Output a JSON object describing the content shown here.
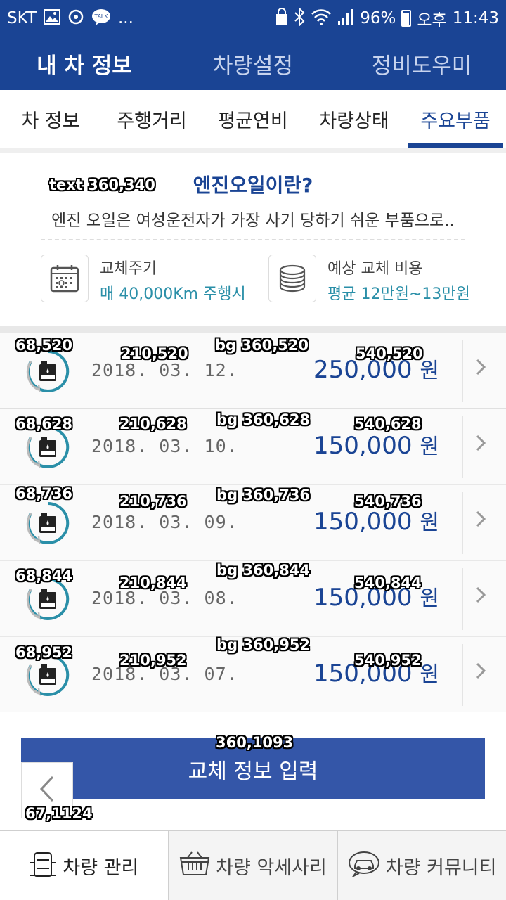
{
  "status_bar": {
    "carrier": "SKT",
    "talk_label": "TALK",
    "more": "...",
    "battery": "96%",
    "ampm": "오후",
    "time": "11:43"
  },
  "top_nav": {
    "items": [
      "내 차 정보",
      "차량설정",
      "정비도우미"
    ],
    "active": "내 차 정보"
  },
  "sub_tabs": {
    "items": [
      "차 정보",
      "주행거리",
      "평균연비",
      "차량상태",
      "주요부품"
    ],
    "active": "주요부품"
  },
  "info": {
    "title": "엔진오일이란?",
    "description": "엔진 오일은 여성운전자가 가장 사기 당하기 쉬운 부품으로..",
    "cycle_label": "교체주기",
    "cycle_value": "매 40,000Km 주행시",
    "cost_label": "예상 교체 비용",
    "cost_value": "평균 12만원~13만원",
    "calendar_icon": "calendar-icon",
    "coins_icon": "coins-icon"
  },
  "history": [
    {
      "date": "2018. 03. 12.",
      "amount": "250,000",
      "unit": "원"
    },
    {
      "date": "2018. 03. 10.",
      "amount": "150,000",
      "unit": "원"
    },
    {
      "date": "2018. 03. 09.",
      "amount": "150,000",
      "unit": "원"
    },
    {
      "date": "2018. 03. 08.",
      "amount": "150,000",
      "unit": "원"
    },
    {
      "date": "2018. 03. 07.",
      "amount": "150,000",
      "unit": "원"
    }
  ],
  "overlay_labels": {
    "info_text": "text 360,340",
    "rows": [
      {
        "icon": "68,520",
        "date": "210,520",
        "bg": "bg 360,520",
        "amount": "540,520"
      },
      {
        "icon": "68,628",
        "date": "210,628",
        "bg": "bg 360,628",
        "amount": "540,628"
      },
      {
        "icon": "68,736",
        "date": "210,736",
        "bg": "bg 360,736",
        "amount": "540,736"
      },
      {
        "icon": "68,844",
        "date": "210,844",
        "bg": "bg 360,844",
        "amount": "540,844"
      },
      {
        "icon": "68,952",
        "date": "210,952",
        "bg": "bg 360,952",
        "amount": "540,952"
      }
    ],
    "button": "360,1093",
    "back": "67,1124"
  },
  "input_button": {
    "label": "교체 정보 입력"
  },
  "bottom_bar": {
    "items": [
      "차량 관리",
      "차량 악세사리",
      "차량 커뮤니티"
    ]
  },
  "colors": {
    "brand": "#1a4494",
    "accent_teal": "#2a8fa8",
    "button": "#3456a8"
  }
}
